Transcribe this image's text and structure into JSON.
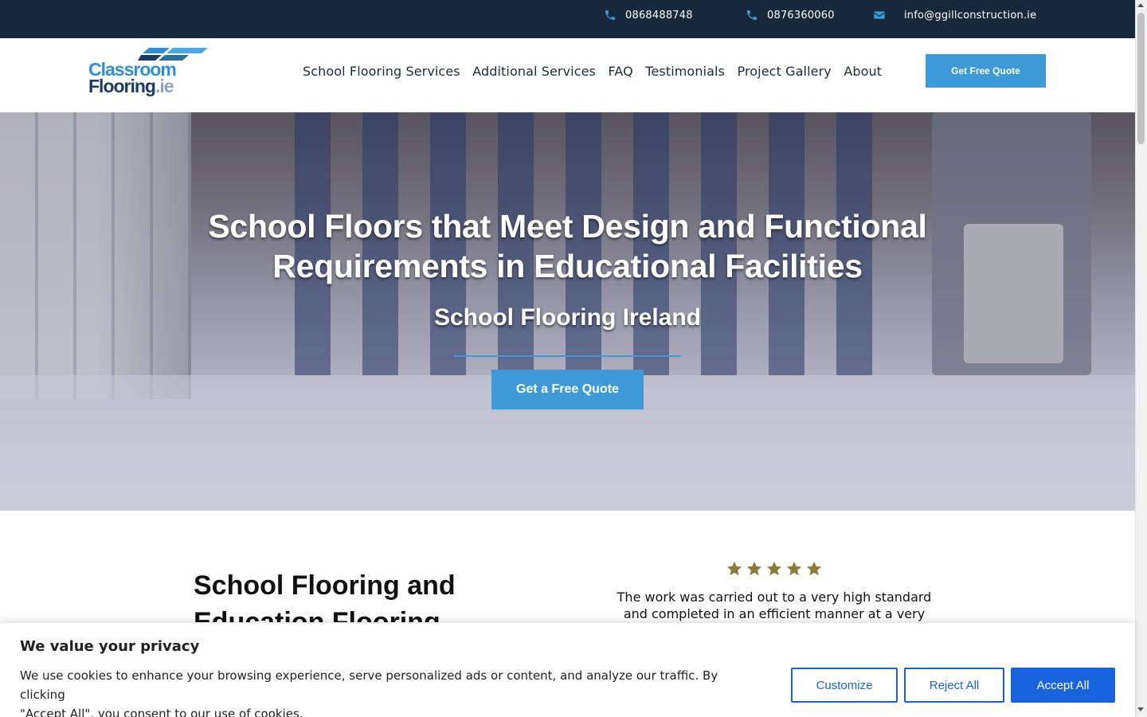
{
  "topbar": {
    "phone1": "0868488748",
    "phone2": "0876360060",
    "email": "info@ggillconstruction.ie",
    "icon_color": "#3d9ad6",
    "background": "#17283a"
  },
  "logo": {
    "line1": "Classroom",
    "line2": "Flooring",
    "suffix": ".ie"
  },
  "nav": {
    "items": [
      "School Flooring Services",
      "Additional Services",
      "FAQ",
      "Testimonials",
      "Project Gallery",
      "About"
    ],
    "quote_label": "Get Free Quote"
  },
  "hero": {
    "title_line1": "School Floors that Meet Design and Functional",
    "title_line2": "Requirements in Educational Facilities",
    "subtitle": "School Flooring Ireland",
    "cta_label": "Get a Free Quote",
    "accent": "#3d9ad6"
  },
  "content": {
    "title_line1": "School Flooring and",
    "title_line2": "Education Flooring",
    "rating": 5,
    "star_color": "#8a7d3a",
    "review_line1": "The work was carried out to a very high standard",
    "review_line2": "and completed in an efficient manner at a very"
  },
  "cookie": {
    "title": "We value your privacy",
    "text_line1": "We use cookies to enhance your browsing experience, serve personalized ads or content, and analyze our traffic. By clicking",
    "text_line2": "\"Accept All\", you consent to our use of cookies.",
    "customize_label": "Customize",
    "reject_label": "Reject All",
    "accept_label": "Accept All",
    "button_color": "#1863dc"
  }
}
